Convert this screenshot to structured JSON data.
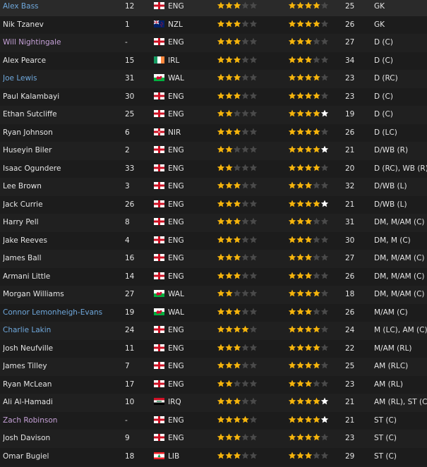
{
  "colors": {
    "star_gold": "#f5b40c",
    "star_white": "#ffffff",
    "star_empty": "#4a4a4a",
    "name_default": "#e4e4e4",
    "name_blue": "#6fa8dc",
    "name_purple": "#c4a0d6"
  },
  "players": [
    {
      "name": "Alex Bass",
      "name_style": "blue",
      "number": "12",
      "nat_code": "ENG",
      "flag": "eng",
      "ca": {
        "value": 3.5,
        "color": "gold"
      },
      "pa": {
        "value": 4.5,
        "color": "gold"
      },
      "age": "25",
      "position": "GK"
    },
    {
      "name": "Nik Tzanev",
      "name_style": "default",
      "number": "1",
      "nat_code": "NZL",
      "flag": "nzl",
      "ca": {
        "value": 3,
        "color": "gold"
      },
      "pa": {
        "value": 4,
        "color": "gold"
      },
      "age": "26",
      "position": "GK"
    },
    {
      "name": "Will Nightingale",
      "name_style": "purple",
      "number": "-",
      "nat_code": "ENG",
      "flag": "eng",
      "ca": {
        "value": 3,
        "color": "gold"
      },
      "pa": {
        "value": 3.5,
        "color": "gold"
      },
      "age": "27",
      "position": "D (C)"
    },
    {
      "name": "Alex Pearce",
      "name_style": "default",
      "number": "15",
      "nat_code": "IRL",
      "flag": "irl",
      "ca": {
        "value": 3,
        "color": "gold"
      },
      "pa": {
        "value": 3,
        "color": "gold"
      },
      "age": "34",
      "position": "D (C)"
    },
    {
      "name": "Joe Lewis",
      "name_style": "blue",
      "number": "31",
      "nat_code": "WAL",
      "flag": "wal",
      "ca": {
        "value": 3,
        "color": "gold"
      },
      "pa": {
        "value": 4.5,
        "color": "gold"
      },
      "age": "23",
      "position": "D (RC)"
    },
    {
      "name": "Paul Kalambayi",
      "name_style": "default",
      "number": "30",
      "nat_code": "ENG",
      "flag": "eng",
      "ca": {
        "value": 3,
        "color": "gold"
      },
      "pa": {
        "value": 4.5,
        "color": "gold"
      },
      "age": "23",
      "position": "D (C)"
    },
    {
      "name": "Ethan Sutcliffe",
      "name_style": "default",
      "number": "25",
      "nat_code": "ENG",
      "flag": "eng",
      "ca": {
        "value": 2,
        "color": "gold"
      },
      "pa": {
        "value": 5,
        "color": "gold-white"
      },
      "age": "19",
      "position": "D (C)"
    },
    {
      "name": "Ryan Johnson",
      "name_style": "default",
      "number": "6",
      "nat_code": "NIR",
      "flag": "nir",
      "ca": {
        "value": 3,
        "color": "gold"
      },
      "pa": {
        "value": 4,
        "color": "gold"
      },
      "age": "26",
      "position": "D (LC)"
    },
    {
      "name": "Huseyin Biler",
      "name_style": "default",
      "number": "2",
      "nat_code": "ENG",
      "flag": "eng",
      "ca": {
        "value": 2.5,
        "color": "gold"
      },
      "pa": {
        "value": 5,
        "color": "gold-white"
      },
      "age": "21",
      "position": "D/WB (R)"
    },
    {
      "name": "Isaac Ogundere",
      "name_style": "default",
      "number": "33",
      "nat_code": "ENG",
      "flag": "eng",
      "ca": {
        "value": 2.5,
        "color": "gold"
      },
      "pa": {
        "value": 4.5,
        "color": "gold-white"
      },
      "age": "20",
      "position": "D (RC), WB (R)"
    },
    {
      "name": "Lee Brown",
      "name_style": "default",
      "number": "3",
      "nat_code": "ENG",
      "flag": "eng",
      "ca": {
        "value": 3,
        "color": "gold"
      },
      "pa": {
        "value": 3,
        "color": "gold"
      },
      "age": "32",
      "position": "D/WB (L)"
    },
    {
      "name": "Jack Currie",
      "name_style": "default",
      "number": "26",
      "nat_code": "ENG",
      "flag": "eng",
      "ca": {
        "value": 3,
        "color": "gold"
      },
      "pa": {
        "value": 5,
        "color": "gold-white"
      },
      "age": "21",
      "position": "D/WB (L)"
    },
    {
      "name": "Harry Pell",
      "name_style": "default",
      "number": "8",
      "nat_code": "ENG",
      "flag": "eng",
      "ca": {
        "value": 3,
        "color": "gold"
      },
      "pa": {
        "value": 3,
        "color": "gold"
      },
      "age": "31",
      "position": "DM, M/AM (C)"
    },
    {
      "name": "Jake Reeves",
      "name_style": "default",
      "number": "4",
      "nat_code": "ENG",
      "flag": "eng",
      "ca": {
        "value": 3.5,
        "color": "gold"
      },
      "pa": {
        "value": 3.5,
        "color": "gold"
      },
      "age": "30",
      "position": "DM, M (C)"
    },
    {
      "name": "James Ball",
      "name_style": "default",
      "number": "16",
      "nat_code": "ENG",
      "flag": "eng",
      "ca": {
        "value": 3,
        "color": "gold"
      },
      "pa": {
        "value": 3,
        "color": "gold"
      },
      "age": "27",
      "position": "DM, M/AM (C)"
    },
    {
      "name": "Armani Little",
      "name_style": "default",
      "number": "14",
      "nat_code": "ENG",
      "flag": "eng",
      "ca": {
        "value": 3,
        "color": "gold"
      },
      "pa": {
        "value": 3.5,
        "color": "gold"
      },
      "age": "26",
      "position": "DM, M/AM (C)"
    },
    {
      "name": "Morgan Williams",
      "name_style": "default",
      "number": "27",
      "nat_code": "WAL",
      "flag": "wal",
      "ca": {
        "value": 2,
        "color": "gold"
      },
      "pa": {
        "value": 4.5,
        "color": "gold-white"
      },
      "age": "18",
      "position": "DM, M/AM (C)"
    },
    {
      "name": "Connor Lemonheigh-Evans",
      "name_style": "blue",
      "number": "19",
      "nat_code": "WAL",
      "flag": "wal",
      "ca": {
        "value": 3,
        "color": "gold"
      },
      "pa": {
        "value": 3,
        "color": "gold"
      },
      "age": "26",
      "position": "M/AM (C)"
    },
    {
      "name": "Charlie Lakin",
      "name_style": "blue",
      "number": "24",
      "nat_code": "ENG",
      "flag": "eng",
      "ca": {
        "value": 4,
        "color": "gold"
      },
      "pa": {
        "value": 4.5,
        "color": "gold"
      },
      "age": "24",
      "position": "M (LC), AM (C)"
    },
    {
      "name": "Josh Neufville",
      "name_style": "default",
      "number": "11",
      "nat_code": "ENG",
      "flag": "eng",
      "ca": {
        "value": 3,
        "color": "gold"
      },
      "pa": {
        "value": 4.5,
        "color": "gold"
      },
      "age": "22",
      "position": "M/AM (RL)"
    },
    {
      "name": "James Tilley",
      "name_style": "default",
      "number": "7",
      "nat_code": "ENG",
      "flag": "eng",
      "ca": {
        "value": 3,
        "color": "gold"
      },
      "pa": {
        "value": 4,
        "color": "gold"
      },
      "age": "25",
      "position": "AM (RLC)"
    },
    {
      "name": "Ryan McLean",
      "name_style": "default",
      "number": "17",
      "nat_code": "ENG",
      "flag": "eng",
      "ca": {
        "value": 2.5,
        "color": "gold"
      },
      "pa": {
        "value": 3,
        "color": "gold"
      },
      "age": "23",
      "position": "AM (RL)"
    },
    {
      "name": "Ali Al-Hamadi",
      "name_style": "default",
      "number": "10",
      "nat_code": "IRQ",
      "flag": "irq",
      "ca": {
        "value": 3.5,
        "color": "gold"
      },
      "pa": {
        "value": 5,
        "color": "gold-white"
      },
      "age": "21",
      "position": "AM (RL), ST (C)"
    },
    {
      "name": "Zach Robinson",
      "name_style": "purple",
      "number": "-",
      "nat_code": "ENG",
      "flag": "eng",
      "ca": {
        "value": 4,
        "color": "gold"
      },
      "pa": {
        "value": 5,
        "color": "gold-white"
      },
      "age": "21",
      "position": "ST (C)"
    },
    {
      "name": "Josh Davison",
      "name_style": "default",
      "number": "9",
      "nat_code": "ENG",
      "flag": "eng",
      "ca": {
        "value": 3,
        "color": "gold"
      },
      "pa": {
        "value": 4.5,
        "color": "gold"
      },
      "age": "23",
      "position": "ST (C)"
    },
    {
      "name": "Omar Bugiel",
      "name_style": "default",
      "number": "18",
      "nat_code": "LIB",
      "flag": "lib",
      "ca": {
        "value": 3,
        "color": "gold"
      },
      "pa": {
        "value": 3,
        "color": "gold"
      },
      "age": "29",
      "position": "ST (C)"
    }
  ]
}
